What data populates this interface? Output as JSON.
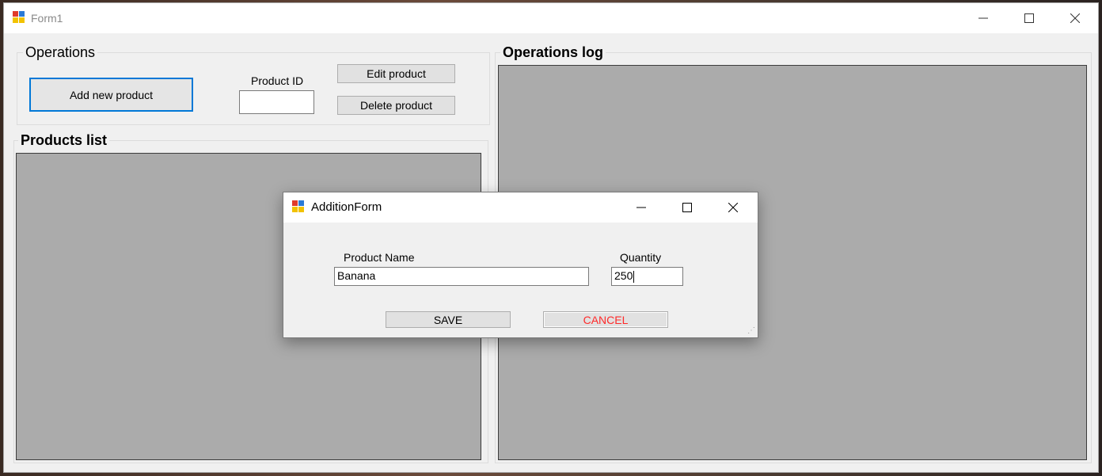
{
  "main_window": {
    "title": "Form1",
    "icon": "app-icon",
    "controls": {
      "minimize": "minimize-icon",
      "maximize": "maximize-icon",
      "close": "close-icon"
    }
  },
  "operations": {
    "legend": "Operations",
    "add_button": "Add new product",
    "product_id_label": "Product ID",
    "product_id_value": "",
    "edit_button": "Edit product",
    "delete_button": "Delete product"
  },
  "products_list": {
    "legend": "Products list"
  },
  "operations_log": {
    "legend": "Operations log"
  },
  "dialog": {
    "title": "AdditionForm",
    "icon": "app-icon",
    "product_name_label": "Product Name",
    "product_name_value": "Banana",
    "quantity_label": "Quantity",
    "quantity_value": "250",
    "save_button": "SAVE",
    "cancel_button": "CANCEL"
  },
  "colors": {
    "focus_border": "#0078d7",
    "cancel_text": "#ff2a2a",
    "panel_fill": "#ababab"
  }
}
